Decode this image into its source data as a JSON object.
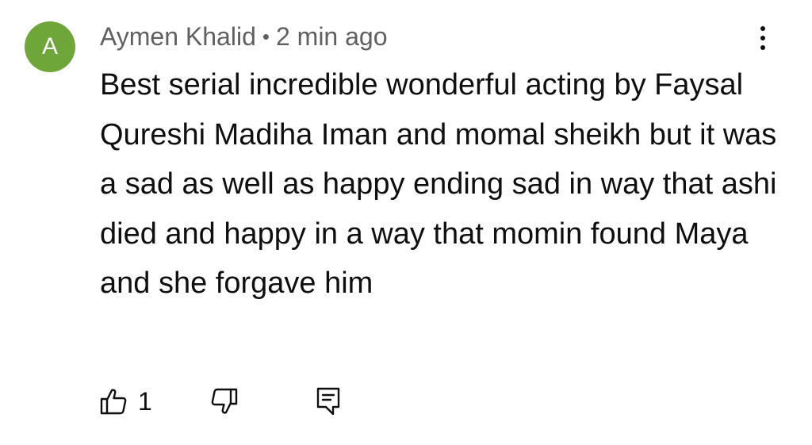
{
  "comment": {
    "avatar_letter": "A",
    "avatar_color": "#6fa63a",
    "author": "Aymen Khalid",
    "separator": "•",
    "timestamp": "2 min ago",
    "text": "Best serial incredible wonderful acting by Faysal Qureshi Madiha Iman and momal sheikh but it was a sad as well as happy ending sad in way that ashi died and happy in a way that momin found Maya and she forgave him",
    "like_count": "1",
    "icons": {
      "menu": "more-vert-icon",
      "like": "thumb-up-icon",
      "dislike": "thumb-down-icon",
      "reply": "comment-icon"
    }
  }
}
